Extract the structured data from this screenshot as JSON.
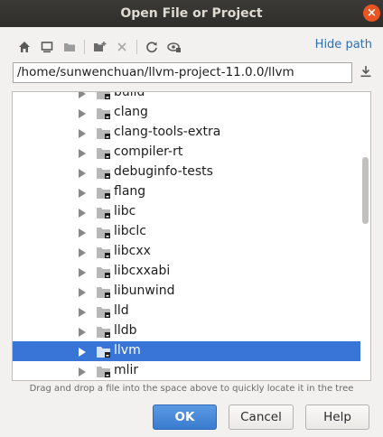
{
  "window": {
    "title": "Open File or Project",
    "close_glyph": "×"
  },
  "toolbar": {
    "icons": [
      "home-icon",
      "desktop-icon",
      "project-folder-icon",
      "new-folder-icon",
      "delete-icon",
      "refresh-icon",
      "show-hidden-icon"
    ],
    "hide_path_label": "Hide path"
  },
  "path": {
    "value": "/home/sunwenchuan/llvm-project-11.0.0/llvm"
  },
  "tree": {
    "items": [
      {
        "label": "build",
        "selected": false
      },
      {
        "label": "clang",
        "selected": false
      },
      {
        "label": "clang-tools-extra",
        "selected": false
      },
      {
        "label": "compiler-rt",
        "selected": false
      },
      {
        "label": "debuginfo-tests",
        "selected": false
      },
      {
        "label": "flang",
        "selected": false
      },
      {
        "label": "libc",
        "selected": false
      },
      {
        "label": "libclc",
        "selected": false
      },
      {
        "label": "libcxx",
        "selected": false
      },
      {
        "label": "libcxxabi",
        "selected": false
      },
      {
        "label": "libunwind",
        "selected": false
      },
      {
        "label": "lld",
        "selected": false
      },
      {
        "label": "lldb",
        "selected": false
      },
      {
        "label": "llvm",
        "selected": true
      },
      {
        "label": "mlir",
        "selected": false
      }
    ]
  },
  "hint": "Drag and drop a file into the space above to quickly locate it in the tree",
  "buttons": {
    "ok": "OK",
    "cancel": "Cancel",
    "help": "Help"
  },
  "colors": {
    "accent": "#3875d7",
    "link": "#2f6fb0",
    "titlebar": "#2f2e2b",
    "close": "#e95420"
  }
}
